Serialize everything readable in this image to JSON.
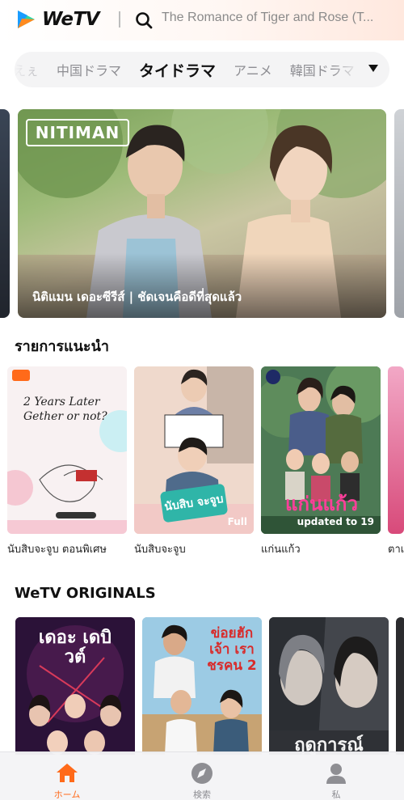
{
  "header": {
    "brand": "WeTV",
    "search_placeholder": "The Romance of Tiger and Rose (T..."
  },
  "tabs": [
    {
      "label": "えぇ",
      "state": "faded"
    },
    {
      "label": "中国ドラマ",
      "state": "normal"
    },
    {
      "label": "タイドラマ",
      "state": "active"
    },
    {
      "label": "アニメ",
      "state": "normal"
    },
    {
      "label": "韓国ドラマ",
      "state": "normal"
    }
  ],
  "banner": {
    "logo_text": "NITIMAN",
    "caption": "นิติแมน เดอะซีรีส์ | ชัดเจนคือดีที่สุดแล้ว"
  },
  "recommended": {
    "title": "รายการแนะนำ",
    "items": [
      {
        "label": "นับสิบจะจูบ ตอนพิเศษ",
        "poster_title": "2 Years Later Gether or not?",
        "badge": ""
      },
      {
        "label": "นับสิบจะจูบ",
        "poster_title": "นับสิบ จะจูบ",
        "badge": "Full"
      },
      {
        "label": "แก่นแก้ว",
        "poster_title": "แก่นแก้ว",
        "badge": "updated to 19"
      },
      {
        "label": "ตาเ",
        "poster_title": "",
        "badge": ""
      }
    ]
  },
  "originals": {
    "title": "WeTV ORIGINALS",
    "items": [
      {
        "poster_title": "เดอะ เดบิวต์"
      },
      {
        "poster_title": "ข่อยฮักเจ้า เราชรคน 2"
      },
      {
        "poster_title": "ฤดูการณ์ ตาม"
      }
    ]
  },
  "bottom_nav": [
    {
      "label": "ホーム",
      "icon": "home-icon",
      "active": true
    },
    {
      "label": "検索",
      "icon": "compass-icon",
      "active": false
    },
    {
      "label": "私",
      "icon": "person-icon",
      "active": false
    }
  ],
  "colors": {
    "accent": "#ff6a1a",
    "text": "#111111",
    "muted": "#8e8e93"
  }
}
